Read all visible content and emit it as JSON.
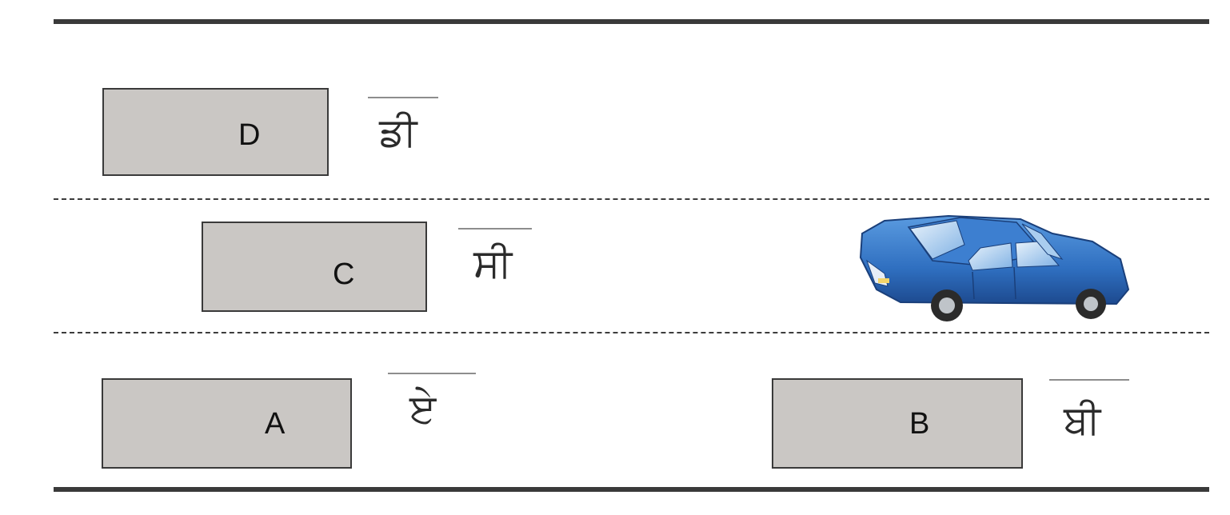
{
  "labels": {
    "box_d": "D",
    "box_c": "C",
    "box_a": "A",
    "box_b": "B"
  },
  "gurmukhi": {
    "d": "ਡੀ",
    "c": "ਸੀ",
    "a": "ਏ",
    "b": "ਬੀ"
  },
  "colors": {
    "box_fill": "#cac7c4",
    "line": "#3a3a3a",
    "car_body": "#2f6fc0"
  },
  "icons": {
    "car": "blue-sedan-car-icon"
  }
}
